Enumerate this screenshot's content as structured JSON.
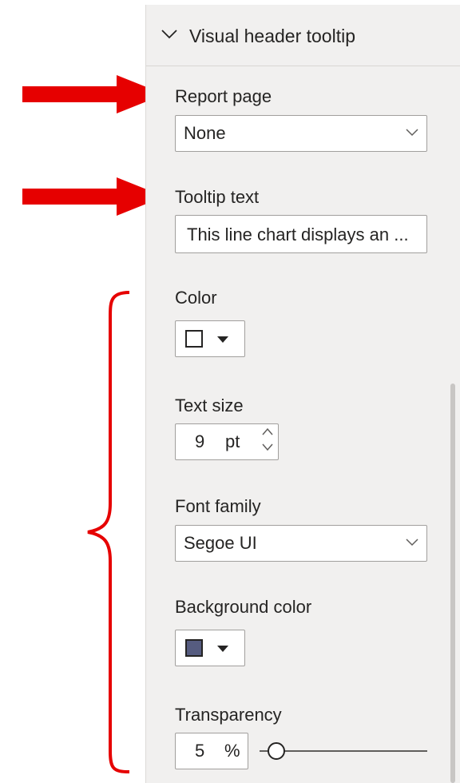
{
  "section": {
    "title": "Visual header tooltip",
    "expanded_icon": "chevron-down-icon"
  },
  "report_page": {
    "label": "Report page",
    "value": "None"
  },
  "tooltip_text": {
    "label": "Tooltip text",
    "value": "This line chart displays an ..."
  },
  "color": {
    "label": "Color",
    "swatch_color": "#ffffff"
  },
  "text_size": {
    "label": "Text size",
    "value": "9",
    "unit": "pt"
  },
  "font_family": {
    "label": "Font family",
    "value": "Segoe UI"
  },
  "background_color": {
    "label": "Background color",
    "swatch_color": "#565c80"
  },
  "transparency": {
    "label": "Transparency",
    "value": "5",
    "unit": "%",
    "level_percent": 5
  },
  "annotations": {
    "arrow_color": "#e60000",
    "arrows": 2,
    "brace": "curly-brace"
  }
}
